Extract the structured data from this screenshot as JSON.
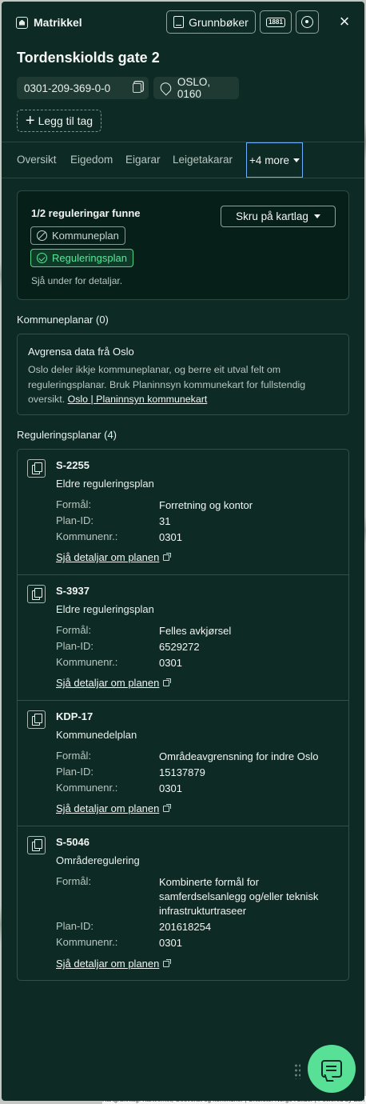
{
  "header": {
    "brand": "Matrikkel",
    "grunnboker_label": "Grunnbøker",
    "badge_1881": "1881"
  },
  "property": {
    "title": "Tordenskiolds gate 2",
    "id": "0301-209-369-0-0",
    "address": "OSLO, 0160",
    "add_tag_label": "Legg til tag"
  },
  "tabs": [
    "Oversikt",
    "Eigedom",
    "Eigarar",
    "Leigetakarar"
  ],
  "tab_more_label": "+4 more",
  "summary": {
    "title": "1/2 reguleringar funne",
    "toggle_label": "Skru på kartlag",
    "pill_kommuneplan": "Kommuneplan",
    "pill_reguleringsplan": "Reguleringsplan",
    "note": "Sjå under for detaljar."
  },
  "kommuneplanar": {
    "heading": "Kommuneplanar (0)",
    "box_title": "Avgrensa data frå Oslo",
    "box_text": "Oslo deler ikkje kommuneplanar, og berre eit utval felt om reguleringsplanar. Bruk Planinnsyn kommunekart for fullstendig oversikt.",
    "box_link": "Oslo | Planinnsyn kommunekart"
  },
  "reguleringsplanar": {
    "heading": "Reguleringsplanar (4)",
    "labels": {
      "formal": "Formål:",
      "plan_id": "Plan-ID:",
      "kommunenr": "Kommunenr.:"
    },
    "link_label": "Sjå detaljar om planen",
    "items": [
      {
        "code": "S-2255",
        "type": "Eldre reguleringsplan",
        "formal": "Forretning og kontor",
        "plan_id": "31",
        "kommunenr": "0301"
      },
      {
        "code": "S-3937",
        "type": "Eldre reguleringsplan",
        "formal": "Felles avkjørsel",
        "plan_id": "6529272",
        "kommunenr": "0301"
      },
      {
        "code": "KDP-17",
        "type": "Kommunedelplan",
        "formal": "Områdeavgrensning for indre Oslo",
        "plan_id": "15137879",
        "kommunenr": "0301"
      },
      {
        "code": "S-5046",
        "type": "Områderegulering",
        "formal": "Kombinerte formål for samferdselsanlegg og/eller teknisk infrastrukturtraseer",
        "plan_id": "201618254",
        "kommunenr": "0301"
      }
    ]
  },
  "map_attribution": "Kartgrunnlag: Kartverket, Geovekst og kommuner | Ortofoto: Norge i bilder | Powered by Esri",
  "colors": {
    "panel": "#0e2a24",
    "accent_green": "#57e096",
    "focus_blue": "#6ab0ff"
  }
}
